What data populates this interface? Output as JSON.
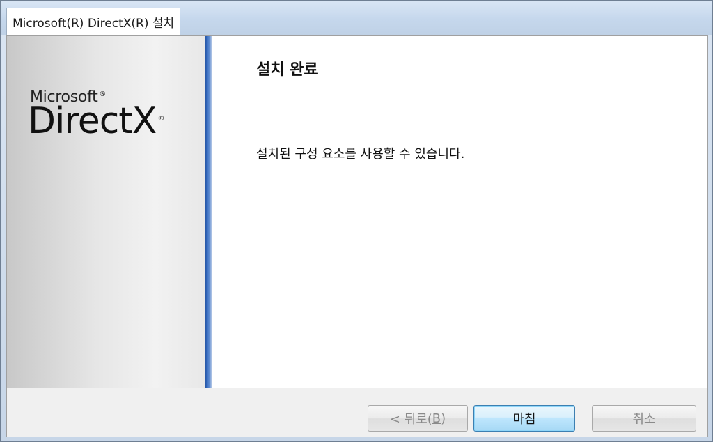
{
  "window": {
    "title": "Microsoft(R) DirectX(R) 설치"
  },
  "side": {
    "logo_microsoft": "Microsoft",
    "logo_directx": "DirectX",
    "registered_mark": "®"
  },
  "content": {
    "title": "설치 완료",
    "message": "설치된 구성 요소를 사용할 수 있습니다."
  },
  "buttons": {
    "back_prefix": "< 뒤로(",
    "back_mnemonic": "B",
    "back_suffix": ")",
    "finish": "마침",
    "cancel": "취소"
  },
  "colors": {
    "accent_bar": "#2f62b3",
    "finish_button_border": "#3c7fb1"
  }
}
